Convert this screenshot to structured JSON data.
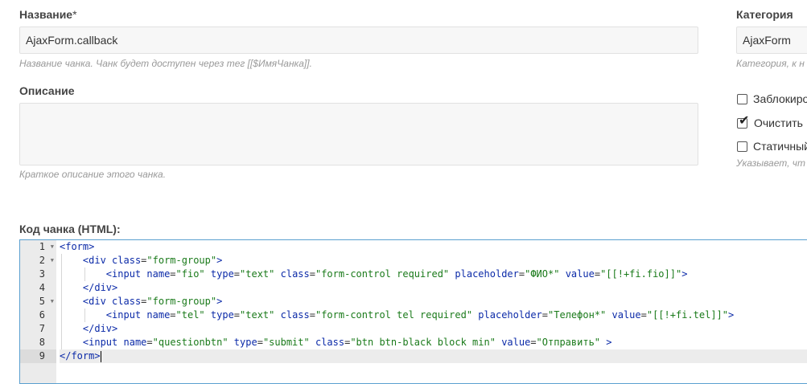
{
  "name_field": {
    "label": "Название",
    "required_mark": "*",
    "value": "AjaxForm.callback",
    "help": "Название чанка. Чанк будет доступен через тег [[$ИмяЧанка]]."
  },
  "category_field": {
    "label": "Категория",
    "value": "AjaxForm",
    "help": "Категория, к н"
  },
  "description_field": {
    "label": "Описание",
    "value": "",
    "help": "Краткое описание этого чанка."
  },
  "checkboxes": [
    {
      "label": "Заблокиро",
      "checked": false
    },
    {
      "label": "Очистить",
      "checked": true
    },
    {
      "label": "Статичный",
      "checked": false
    }
  ],
  "checkbox_help": "Указывает, чт",
  "code_editor": {
    "label": "Код чанка (HTML):",
    "active_line": 9,
    "lines": [
      {
        "num": "1",
        "fold": true
      },
      {
        "num": "2",
        "fold": true
      },
      {
        "num": "3",
        "fold": false
      },
      {
        "num": "4",
        "fold": false
      },
      {
        "num": "5",
        "fold": true
      },
      {
        "num": "6",
        "fold": false
      },
      {
        "num": "7",
        "fold": false
      },
      {
        "num": "8",
        "fold": false
      },
      {
        "num": "9",
        "fold": false
      }
    ],
    "tokens": {
      "l1": [
        "<form>"
      ],
      "l2": [
        "<div",
        "class",
        "=",
        "\"form-group\"",
        ">"
      ],
      "l3": [
        "<input",
        "name",
        "=",
        "\"fio\"",
        "type",
        "=",
        "\"text\"",
        "class",
        "=",
        "\"form-control required\"",
        "placeholder",
        "=",
        "\"ФИО*\"",
        "value",
        "=",
        "\"[[!+fi.fio]]\"",
        ">"
      ],
      "l4": [
        "</div>"
      ],
      "l5": [
        "<div",
        "class",
        "=",
        "\"form-group\"",
        ">"
      ],
      "l6": [
        "<input",
        "name",
        "=",
        "\"tel\"",
        "type",
        "=",
        "\"text\"",
        "class",
        "=",
        "\"form-control tel required\"",
        "placeholder",
        "=",
        "\"Телефон*\"",
        "value",
        "=",
        "\"[[!+fi.tel]]\"",
        ">"
      ],
      "l7": [
        "</div>"
      ],
      "l8": [
        "<input",
        "name",
        "=",
        "\"questionbtn\"",
        "type",
        "=",
        "\"submit\"",
        "class",
        "=",
        "\"btn btn-black block min\"",
        "value",
        "=",
        "\"Отправить\"",
        ">"
      ],
      "l9": [
        "</form>"
      ]
    }
  },
  "colors": {
    "tag": "#0b2aa8",
    "string": "#1a7a1a",
    "editor_border": "#5aa0d0"
  }
}
